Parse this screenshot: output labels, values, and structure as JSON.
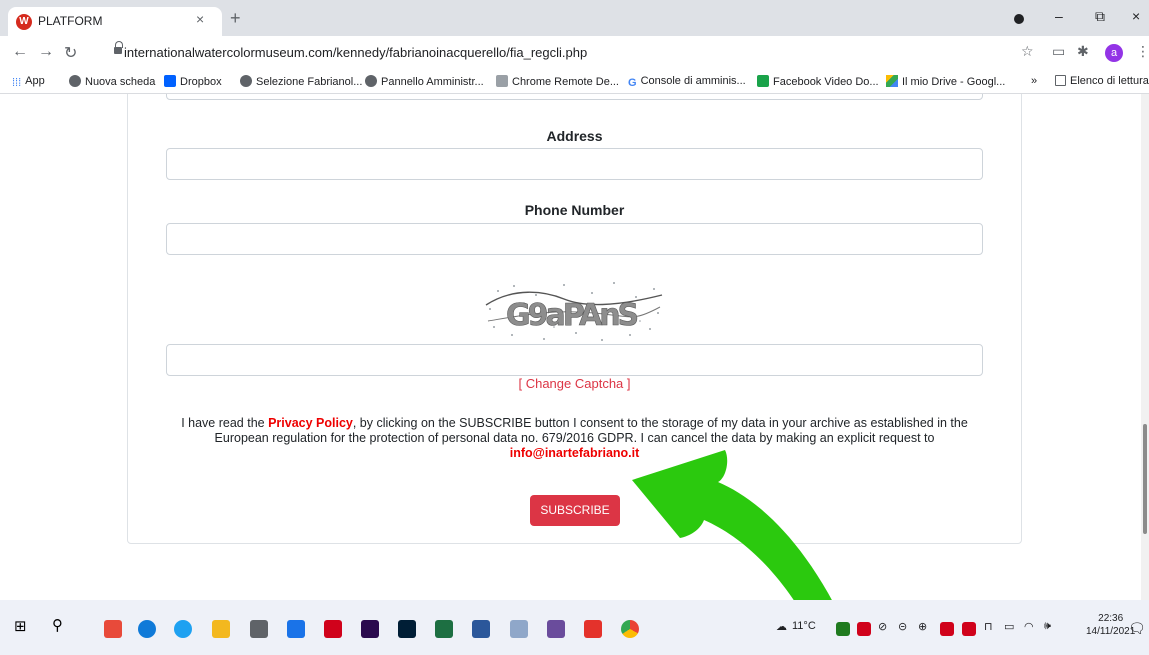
{
  "browser": {
    "tab_title": "PLATFORM",
    "tab_favicon_letter": "W",
    "tab_close": "×",
    "new_tab": "+",
    "url": "internationalwatercolormuseum.com/kennedy/fabrianoinacquerello/fia_regcli.php",
    "avatar_letter": "a",
    "window_minimize": "–",
    "window_restore": "⧉",
    "window_close": "×"
  },
  "bookmarks": {
    "items": [
      "App",
      "Nuova scheda",
      "Dropbox",
      "Selezione Fabrianol...",
      "Pannello Amministr...",
      "Chrome Remote De...",
      "Console di amminis...",
      "Facebook Video Do...",
      "Il mio Drive - Googl..."
    ],
    "more": "»",
    "reading_list": "Elenco di lettura"
  },
  "form": {
    "address_label": "Address",
    "phone_label": "Phone Number",
    "captcha_text": "G9aPAnS",
    "change_captcha": "[ Change Captcha ]",
    "consent_prefix": "I have read the ",
    "privacy_link": "Privacy Policy",
    "consent_body": ", by clicking on the SUBSCRIBE button I consent to the storage of my data in your archive as established in the European regulation for the protection of personal data no. 679/2016 GDPR. I can cancel the data by making an explicit request to",
    "email": "info@inartefabriano.it",
    "subscribe_label": "SUBSCRIBE"
  },
  "taskbar": {
    "weather": "11°C",
    "time": "22:36",
    "date": "14/11/2021"
  },
  "colors": {
    "accent_red": "#dc3545",
    "arrow_green": "#2bc90e"
  }
}
